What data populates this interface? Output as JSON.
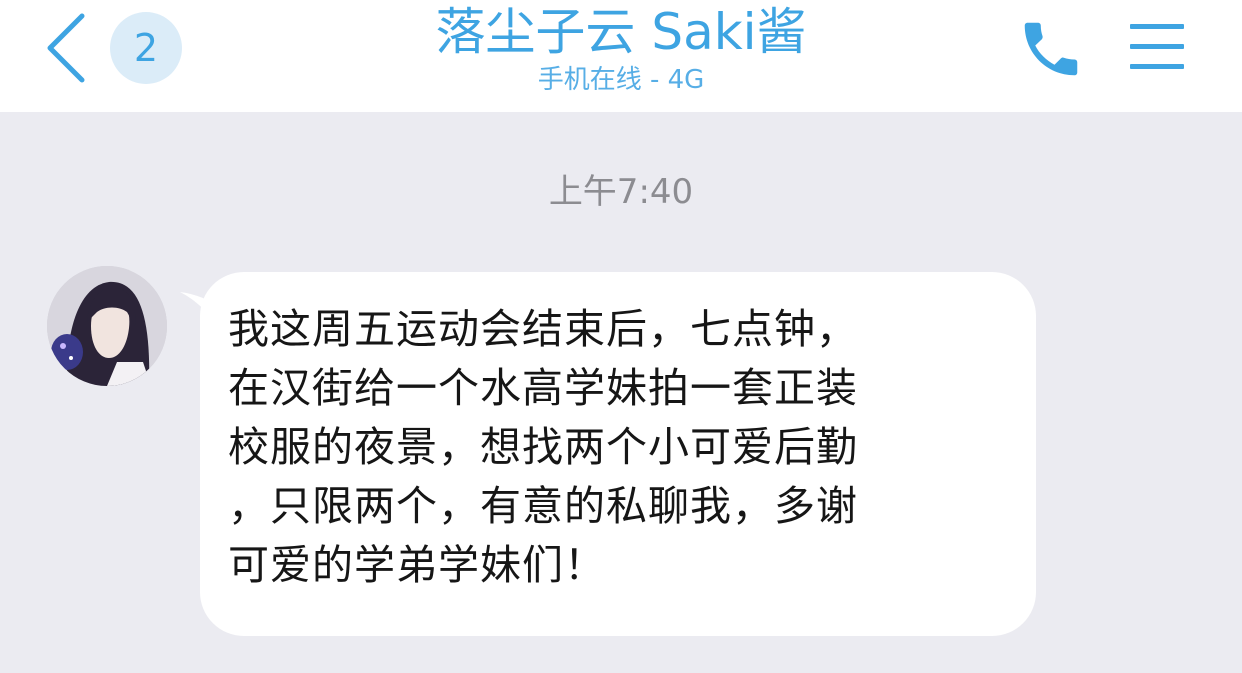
{
  "header": {
    "unread_count": "2",
    "contact_name": "落尘子云 Saki酱",
    "status": "手机在线 - 4G"
  },
  "chat": {
    "timestamp": "上午7:40",
    "messages": [
      {
        "sender": "落尘子云 Saki酱",
        "text": "我这周五运动会结束后，七点钟，\n在汉街给一个水高学妹拍一套正装\n校服的夜景，想找两个小可爱后勤\n，只限两个，有意的私聊我，多谢\n可爱的学弟学妹们！"
      }
    ]
  },
  "icons": {
    "back": "chevron-left-icon",
    "call": "phone-icon",
    "menu": "hamburger-menu-icon"
  },
  "colors": {
    "accent": "#3ea4e2",
    "badge_bg": "#dbecf8",
    "chat_bg": "#ebebf1",
    "bubble_bg": "#ffffff",
    "timestamp_text": "#8c8c91"
  }
}
